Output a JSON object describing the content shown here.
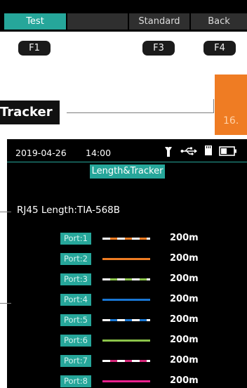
{
  "softkeys": [
    {
      "label": "Test",
      "style": "active"
    },
    {
      "label": "",
      "style": "gray"
    },
    {
      "label": "Standard",
      "style": "gray"
    },
    {
      "label": "Back",
      "style": "gray"
    }
  ],
  "fkeys": [
    "F1",
    "F3",
    "F4"
  ],
  "callout": {
    "label": "Tracker",
    "number": "16."
  },
  "status_bar": {
    "date": "2019-04-26",
    "time": "14:00",
    "icons": [
      "torch-icon",
      "usb-icon",
      "sd-card-icon",
      "battery-icon"
    ]
  },
  "screen_title": "Length&Tracker",
  "standard_text": "RJ45 Length:TIA-568B",
  "ports": [
    {
      "label": "Port:1",
      "length": "200m",
      "wire": "white-orange"
    },
    {
      "label": "Port:2",
      "length": "200m",
      "wire": "orange"
    },
    {
      "label": "Port:3",
      "length": "200m",
      "wire": "white-green"
    },
    {
      "label": "Port:4",
      "length": "200m",
      "wire": "blue"
    },
    {
      "label": "Port:5",
      "length": "200m",
      "wire": "white-blue"
    },
    {
      "label": "Port:6",
      "length": "200m",
      "wire": "green"
    },
    {
      "label": "Port:7",
      "length": "200m",
      "wire": "white-brown"
    },
    {
      "label": "Port:8",
      "length": "200m",
      "wire": "magenta"
    }
  ],
  "colors": {
    "accent": "#26a69a",
    "orange": "#ef7c23"
  }
}
